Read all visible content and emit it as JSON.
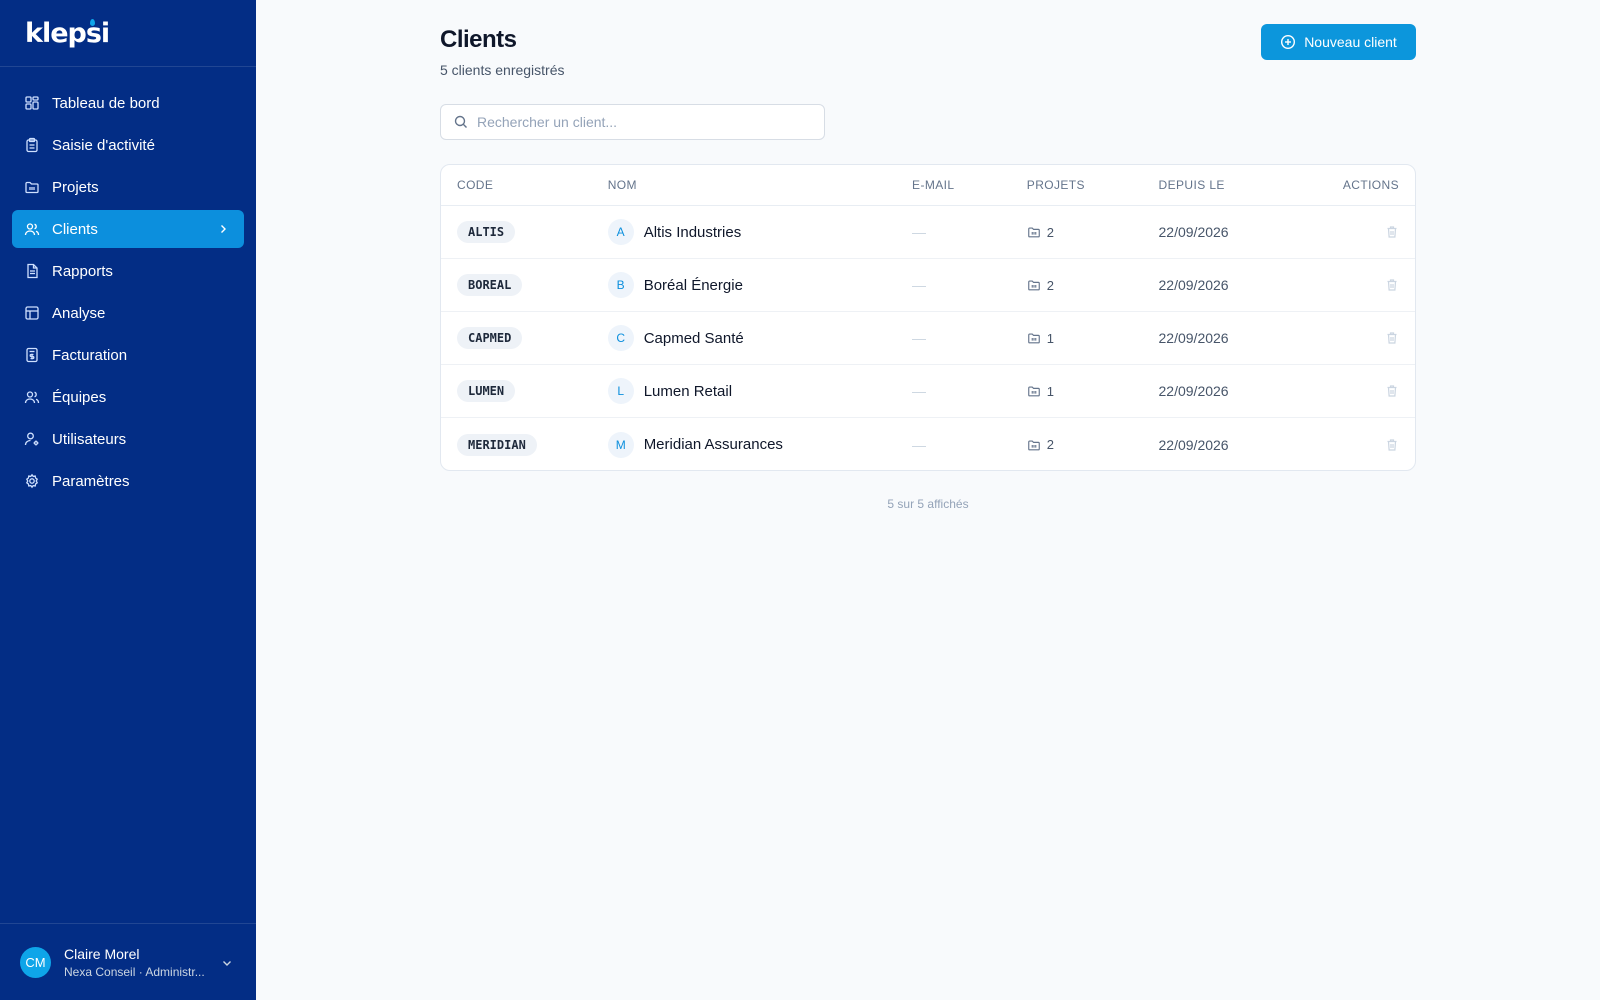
{
  "app": {
    "logo": "klepsi"
  },
  "sidebar": {
    "items": [
      {
        "label": "Tableau de bord",
        "icon": "dashboard-icon"
      },
      {
        "label": "Saisie d'activité",
        "icon": "clipboard-icon"
      },
      {
        "label": "Projets",
        "icon": "folder-icon"
      },
      {
        "label": "Clients",
        "icon": "users-icon",
        "active": true
      },
      {
        "label": "Rapports",
        "icon": "file-icon"
      },
      {
        "label": "Analyse",
        "icon": "table-icon"
      },
      {
        "label": "Facturation",
        "icon": "invoice-icon"
      },
      {
        "label": "Équipes",
        "icon": "team-icon"
      },
      {
        "label": "Utilisateurs",
        "icon": "user-icon"
      },
      {
        "label": "Paramètres",
        "icon": "gear-icon"
      }
    ]
  },
  "user": {
    "initials": "CM",
    "name": "Claire Morel",
    "org": "Nexa Conseil · Administr..."
  },
  "header": {
    "title": "Clients",
    "subtitle": "5 clients enregistrés",
    "new_button": "Nouveau client"
  },
  "search": {
    "placeholder": "Rechercher un client...",
    "value": ""
  },
  "table": {
    "columns": [
      "CODE",
      "NOM",
      "E-MAIL",
      "PROJETS",
      "DEPUIS LE",
      "ACTIONS"
    ],
    "rows": [
      {
        "code": "ALTIS",
        "initial": "A",
        "name": "Altis Industries",
        "email": "—",
        "projects": "2",
        "since": "22/09/2026"
      },
      {
        "code": "BOREAL",
        "initial": "B",
        "name": "Boréal Énergie",
        "email": "—",
        "projects": "2",
        "since": "22/09/2026"
      },
      {
        "code": "CAPMED",
        "initial": "C",
        "name": "Capmed Santé",
        "email": "—",
        "projects": "1",
        "since": "22/09/2026"
      },
      {
        "code": "LUMEN",
        "initial": "L",
        "name": "Lumen Retail",
        "email": "—",
        "projects": "1",
        "since": "22/09/2026"
      },
      {
        "code": "MERIDIAN",
        "initial": "M",
        "name": "Meridian Assurances",
        "email": "—",
        "projects": "2",
        "since": "22/09/2026"
      }
    ]
  },
  "footer": {
    "count_text": "5 sur 5 affichés"
  },
  "colors": {
    "sidebar": "#032d85",
    "accent": "#0c96dc",
    "background": "#f8fafc"
  }
}
